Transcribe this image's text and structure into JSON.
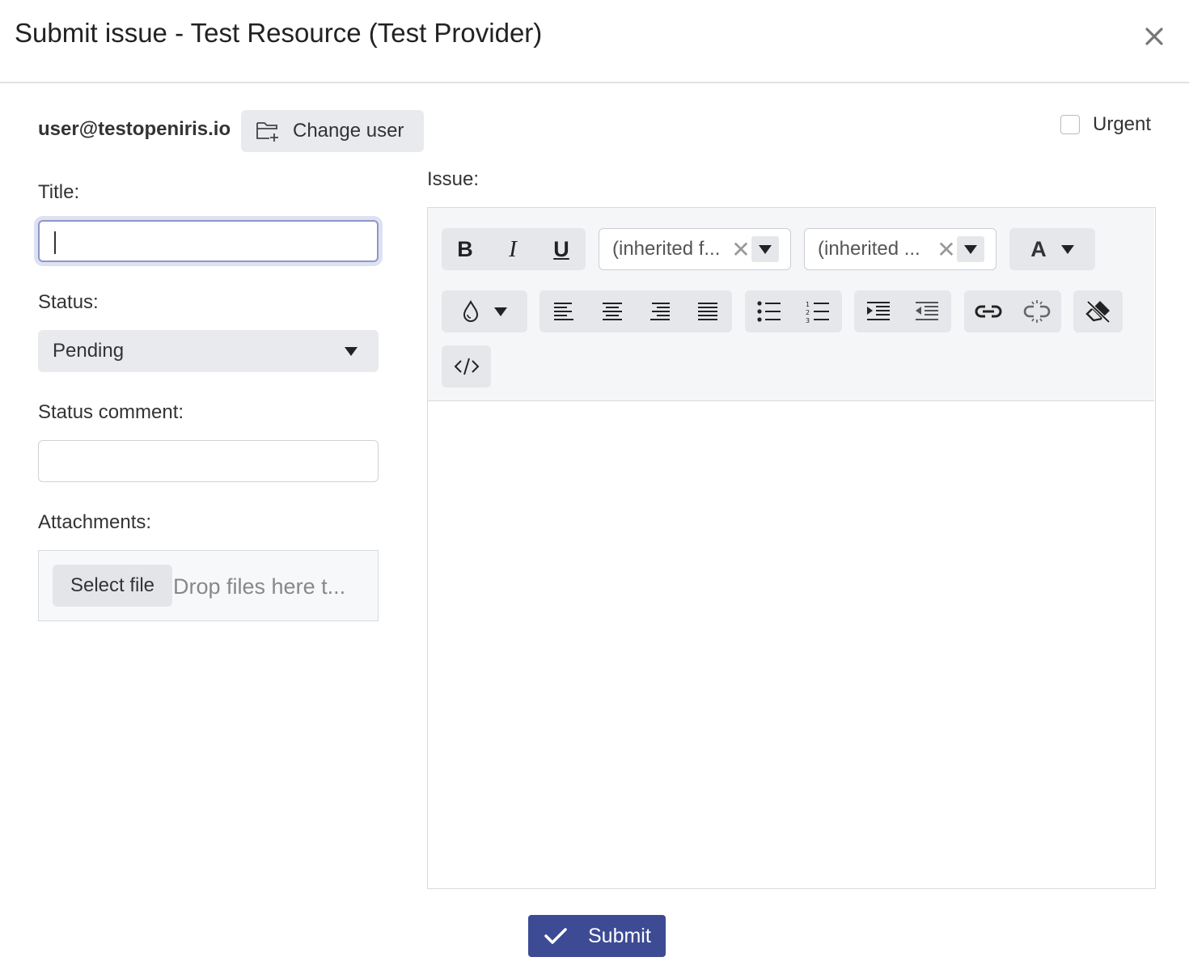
{
  "dialog": {
    "title": "Submit issue - Test Resource (Test Provider)",
    "close_icon": "close-icon"
  },
  "user": {
    "email": "user@testopeniris.io",
    "change_user_label": "Change user",
    "change_user_icon": "folder-add-icon"
  },
  "urgent": {
    "label": "Urgent",
    "checked": false
  },
  "form": {
    "title_label": "Title:",
    "title_value": "",
    "status_label": "Status:",
    "status_value": "Pending",
    "status_comment_label": "Status comment:",
    "status_comment_value": "",
    "attachments_label": "Attachments:",
    "select_file_label": "Select file",
    "drop_placeholder": "Drop files here t..."
  },
  "issue": {
    "label": "Issue:",
    "toolbar": {
      "bold": "B",
      "italic": "I",
      "underline": "U",
      "font_family": "(inherited f...",
      "font_size": "(inherited ...",
      "font_color_label": "A",
      "icons": [
        "bold-icon",
        "italic-icon",
        "underline-icon",
        "font-color-icon",
        "background-color-icon",
        "align-left-icon",
        "align-center-icon",
        "align-right-icon",
        "align-justify-icon",
        "bullet-list-icon",
        "numbered-list-icon",
        "indent-icon",
        "outdent-icon",
        "link-icon",
        "unlink-icon",
        "clear-format-icon",
        "view-html-icon"
      ]
    },
    "content": ""
  },
  "submit": {
    "label": "Submit",
    "icon": "check-icon"
  },
  "colors": {
    "primary": "#3d4a94",
    "button_bg": "#e9eaee",
    "focus_ring": "#dde1f2"
  }
}
